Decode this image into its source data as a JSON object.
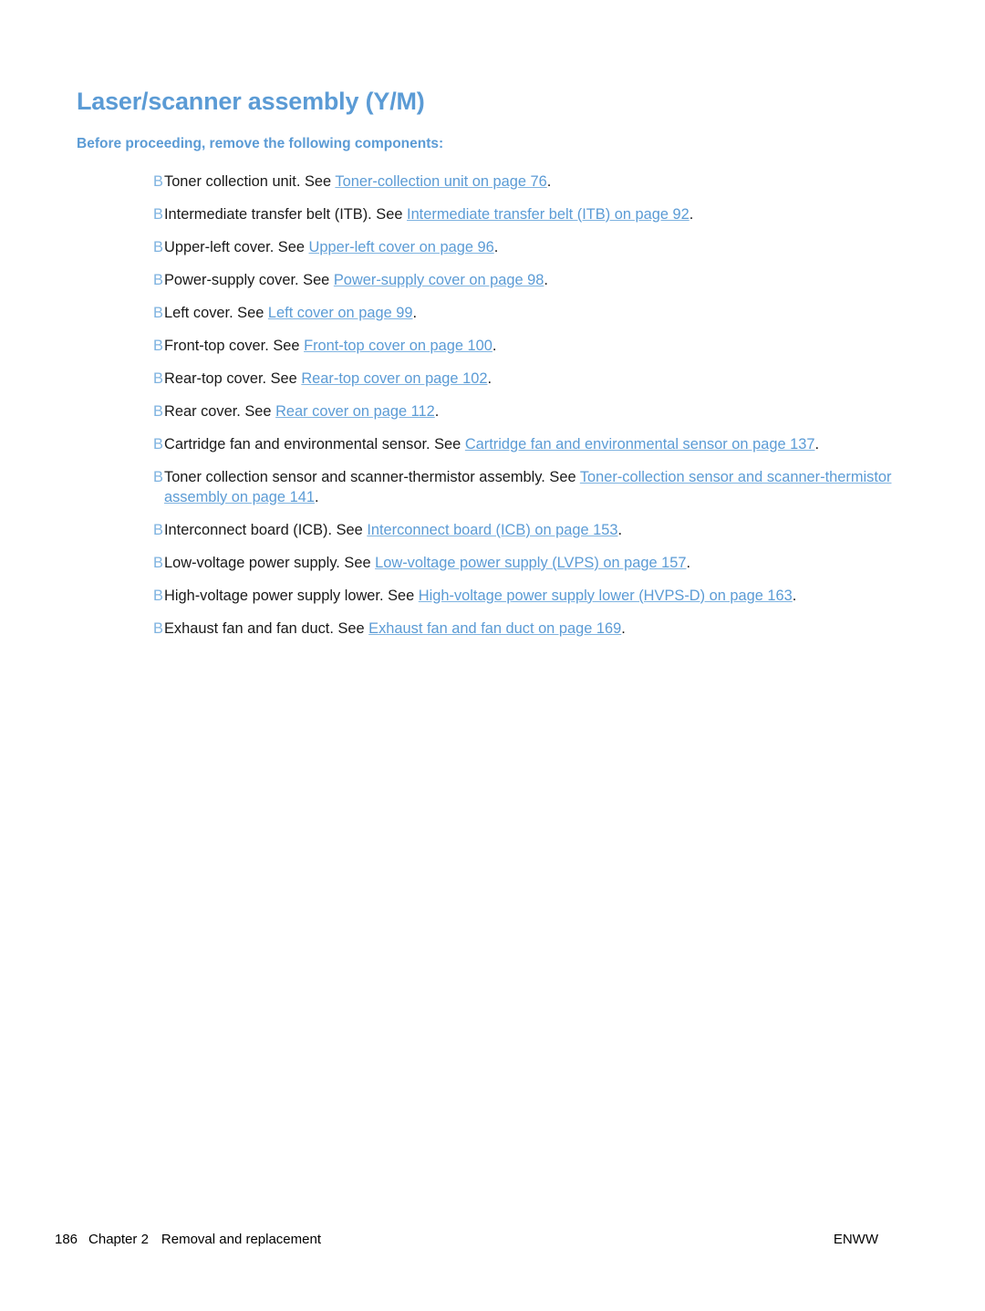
{
  "document": {
    "title": "Laser/scanner assembly (Y/M)",
    "section_lead": "Before proceeding, remove the following components:",
    "bullet_glyph": "B",
    "colors": {
      "heading_blue": "#5b9bd5",
      "link_blue": "#5b9bd5",
      "bullet_blue": "#7fb3e0",
      "body_text": "#1a1a1a",
      "page_background": "#ffffff"
    }
  },
  "components": [
    {
      "text_before": "Toner collection unit. See ",
      "link": "Toner-collection unit on page 76",
      "text_after": "."
    },
    {
      "text_before": "Intermediate transfer belt (ITB). See ",
      "link": "Intermediate transfer belt (ITB) on page 92",
      "text_after": "."
    },
    {
      "text_before": "Upper-left cover. See ",
      "link": "Upper-left cover on page 96",
      "text_after": "."
    },
    {
      "text_before": "Power-supply cover. See ",
      "link": "Power-supply cover on page 98",
      "text_after": "."
    },
    {
      "text_before": "Left cover. See ",
      "link": "Left cover on page 99",
      "text_after": "."
    },
    {
      "text_before": "Front-top cover. See ",
      "link": "Front-top cover on page 100",
      "text_after": "."
    },
    {
      "text_before": "Rear-top cover. See ",
      "link": "Rear-top cover on page 102",
      "text_after": "."
    },
    {
      "text_before": "Rear cover. See ",
      "link": "Rear cover on page 112",
      "text_after": "."
    },
    {
      "text_before": "Cartridge fan and environmental sensor. See ",
      "link": "Cartridge fan and environmental sensor on page 137",
      "text_after": "."
    },
    {
      "text_before": "Toner collection sensor and scanner-thermistor assembly. See ",
      "link": "Toner-collection sensor and scanner-thermistor assembly on page 141",
      "text_after": "."
    },
    {
      "text_before": "Interconnect board (ICB). See ",
      "link": "Interconnect board (ICB) on page 153",
      "text_after": "."
    },
    {
      "text_before": "Low-voltage power supply. See ",
      "link": "Low-voltage power supply (LVPS) on page 157",
      "text_after": "."
    },
    {
      "text_before": "High-voltage power supply lower. See ",
      "link": "High-voltage power supply lower (HVPS-D) on page 163",
      "text_after": "."
    },
    {
      "text_before": "Exhaust fan and fan duct. See ",
      "link": "Exhaust fan and fan duct on page 169",
      "text_after": "."
    }
  ],
  "footer": {
    "page_number": "186",
    "chapter": "Chapter 2",
    "chapter_title": "Removal and replacement",
    "imprint": "ENWW"
  }
}
